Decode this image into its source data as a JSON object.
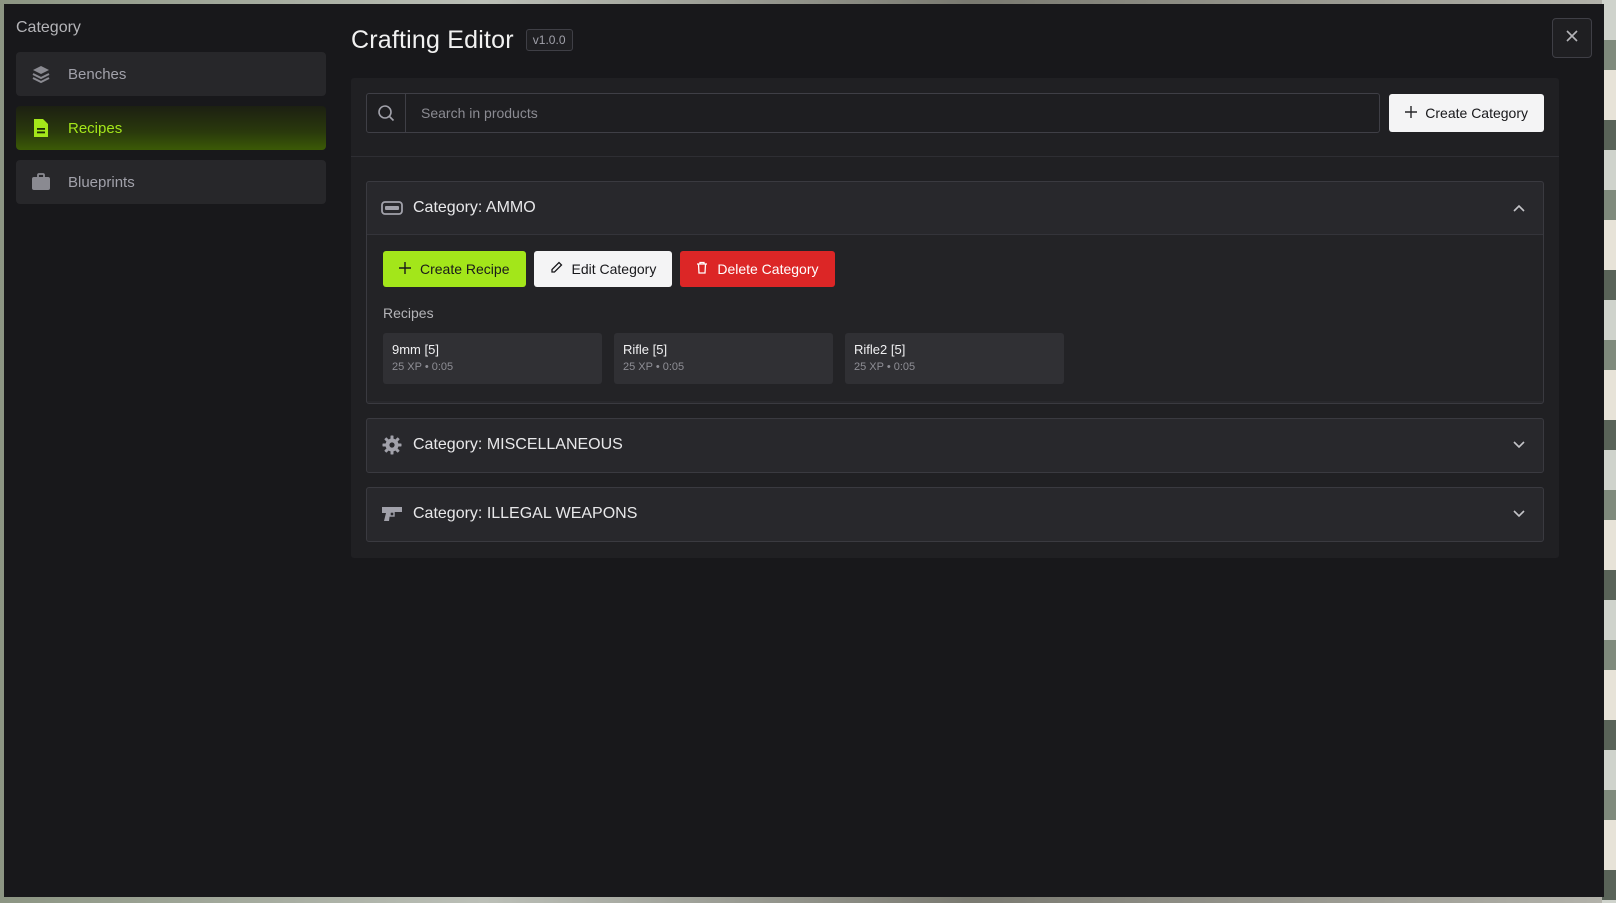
{
  "sidebar": {
    "title": "Category",
    "items": [
      {
        "label": "Benches",
        "icon": "layers-icon",
        "active": false
      },
      {
        "label": "Recipes",
        "icon": "document-icon",
        "active": true
      },
      {
        "label": "Blueprints",
        "icon": "briefcase-icon",
        "active": false
      }
    ]
  },
  "header": {
    "title": "Crafting Editor",
    "version": "v1.0.0"
  },
  "search": {
    "placeholder": "Search in products",
    "value": ""
  },
  "toolbar": {
    "create_category_label": "Create Category"
  },
  "categories": [
    {
      "label": "Category: AMMO",
      "icon": "ammo-icon",
      "expanded": true,
      "actions": {
        "create_recipe": "Create Recipe",
        "edit_category": "Edit Category",
        "delete_category": "Delete Category"
      },
      "recipes_label": "Recipes",
      "recipes": [
        {
          "name": "9mm [5]",
          "meta": "25 XP • 0:05"
        },
        {
          "name": "Rifle [5]",
          "meta": "25 XP • 0:05"
        },
        {
          "name": "Rifle2 [5]",
          "meta": "25 XP • 0:05"
        }
      ]
    },
    {
      "label": "Category: MISCELLANEOUS",
      "icon": "gear-icon",
      "expanded": false
    },
    {
      "label": "Category: ILLEGAL WEAPONS",
      "icon": "pistol-icon",
      "expanded": false
    }
  ],
  "colors": {
    "accent": "#a3e61a",
    "danger": "#dc2626",
    "panel": "#18181b"
  }
}
